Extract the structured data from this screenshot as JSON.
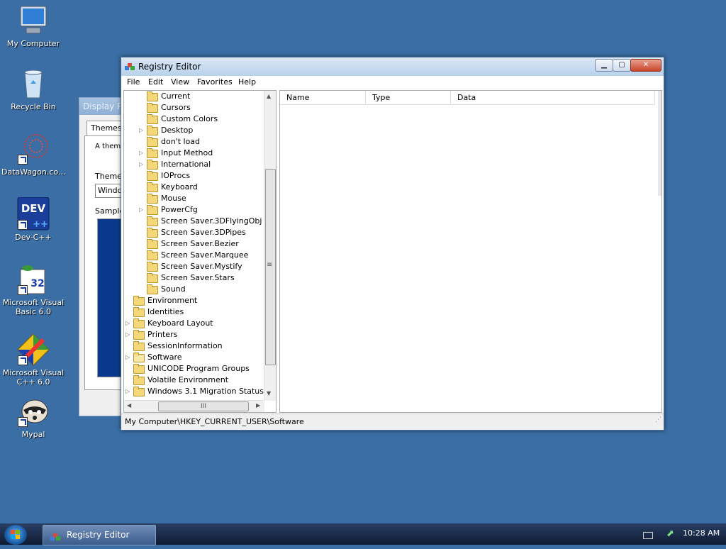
{
  "desktop": {
    "icons": [
      {
        "label": "My Computer"
      },
      {
        "label": "Recycle Bin"
      },
      {
        "label": "DataWagon.co..."
      },
      {
        "label": "Dev-C++",
        "badge": "DEV"
      },
      {
        "label": "Microsoft Visual Basic 6.0",
        "badge": "32"
      },
      {
        "label": "Microsoft Visual C++ 6.0"
      },
      {
        "label": "Mypal"
      }
    ]
  },
  "display_window": {
    "title": "Display Pr",
    "tab": "Themes",
    "text1": "A theme to help",
    "theme_label": "Theme:",
    "theme_value": "Windo",
    "sample_label": "Sample"
  },
  "registry_editor": {
    "title": "Registry Editor",
    "menu": [
      "File",
      "Edit",
      "View",
      "Favorites",
      "Help"
    ],
    "tree": [
      {
        "label": "Current",
        "level": 2,
        "expandable": false
      },
      {
        "label": "Cursors",
        "level": 2,
        "expandable": false
      },
      {
        "label": "Custom Colors",
        "level": 2,
        "expandable": false
      },
      {
        "label": "Desktop",
        "level": 2,
        "expandable": true
      },
      {
        "label": "don't load",
        "level": 2,
        "expandable": false
      },
      {
        "label": "Input Method",
        "level": 2,
        "expandable": true
      },
      {
        "label": "International",
        "level": 2,
        "expandable": true
      },
      {
        "label": "IOProcs",
        "level": 2,
        "expandable": false
      },
      {
        "label": "Keyboard",
        "level": 2,
        "expandable": false
      },
      {
        "label": "Mouse",
        "level": 2,
        "expandable": false
      },
      {
        "label": "PowerCfg",
        "level": 2,
        "expandable": true
      },
      {
        "label": "Screen Saver.3DFlyingObj",
        "level": 2,
        "expandable": false
      },
      {
        "label": "Screen Saver.3DPipes",
        "level": 2,
        "expandable": false
      },
      {
        "label": "Screen Saver.Bezier",
        "level": 2,
        "expandable": false
      },
      {
        "label": "Screen Saver.Marquee",
        "level": 2,
        "expandable": false
      },
      {
        "label": "Screen Saver.Mystify",
        "level": 2,
        "expandable": false
      },
      {
        "label": "Screen Saver.Stars",
        "level": 2,
        "expandable": false
      },
      {
        "label": "Sound",
        "level": 2,
        "expandable": false
      },
      {
        "label": "Environment",
        "level": 1,
        "expandable": false
      },
      {
        "label": "Identities",
        "level": 1,
        "expandable": false
      },
      {
        "label": "Keyboard Layout",
        "level": 1,
        "expandable": true
      },
      {
        "label": "Printers",
        "level": 1,
        "expandable": true
      },
      {
        "label": "SessionInformation",
        "level": 1,
        "expandable": false
      },
      {
        "label": "Software",
        "level": 1,
        "expandable": true,
        "selected": true
      },
      {
        "label": "UNICODE Program Groups",
        "level": 1,
        "expandable": false
      },
      {
        "label": "Volatile Environment",
        "level": 1,
        "expandable": false
      },
      {
        "label": "Windows 3.1 Migration Status",
        "level": 1,
        "expandable": true
      }
    ],
    "columns": [
      "Name",
      "Type",
      "Data"
    ],
    "hscroll_grip": "III",
    "status": "My Computer\\HKEY_CURRENT_USER\\Software"
  },
  "taskbar": {
    "task_label": "Registry Editor",
    "clock": "10:28 AM"
  },
  "colors": {
    "desktop": "#3a6ea5",
    "taskbar": "#0e1a32",
    "folder": "#f3d77a",
    "close_button": "#c8452b"
  },
  "icons": [
    "computer-icon",
    "recycle-bin-icon",
    "folder-icon",
    "registry-icon",
    "windows-start-icon",
    "network-icon",
    "keyboard-icon"
  ]
}
